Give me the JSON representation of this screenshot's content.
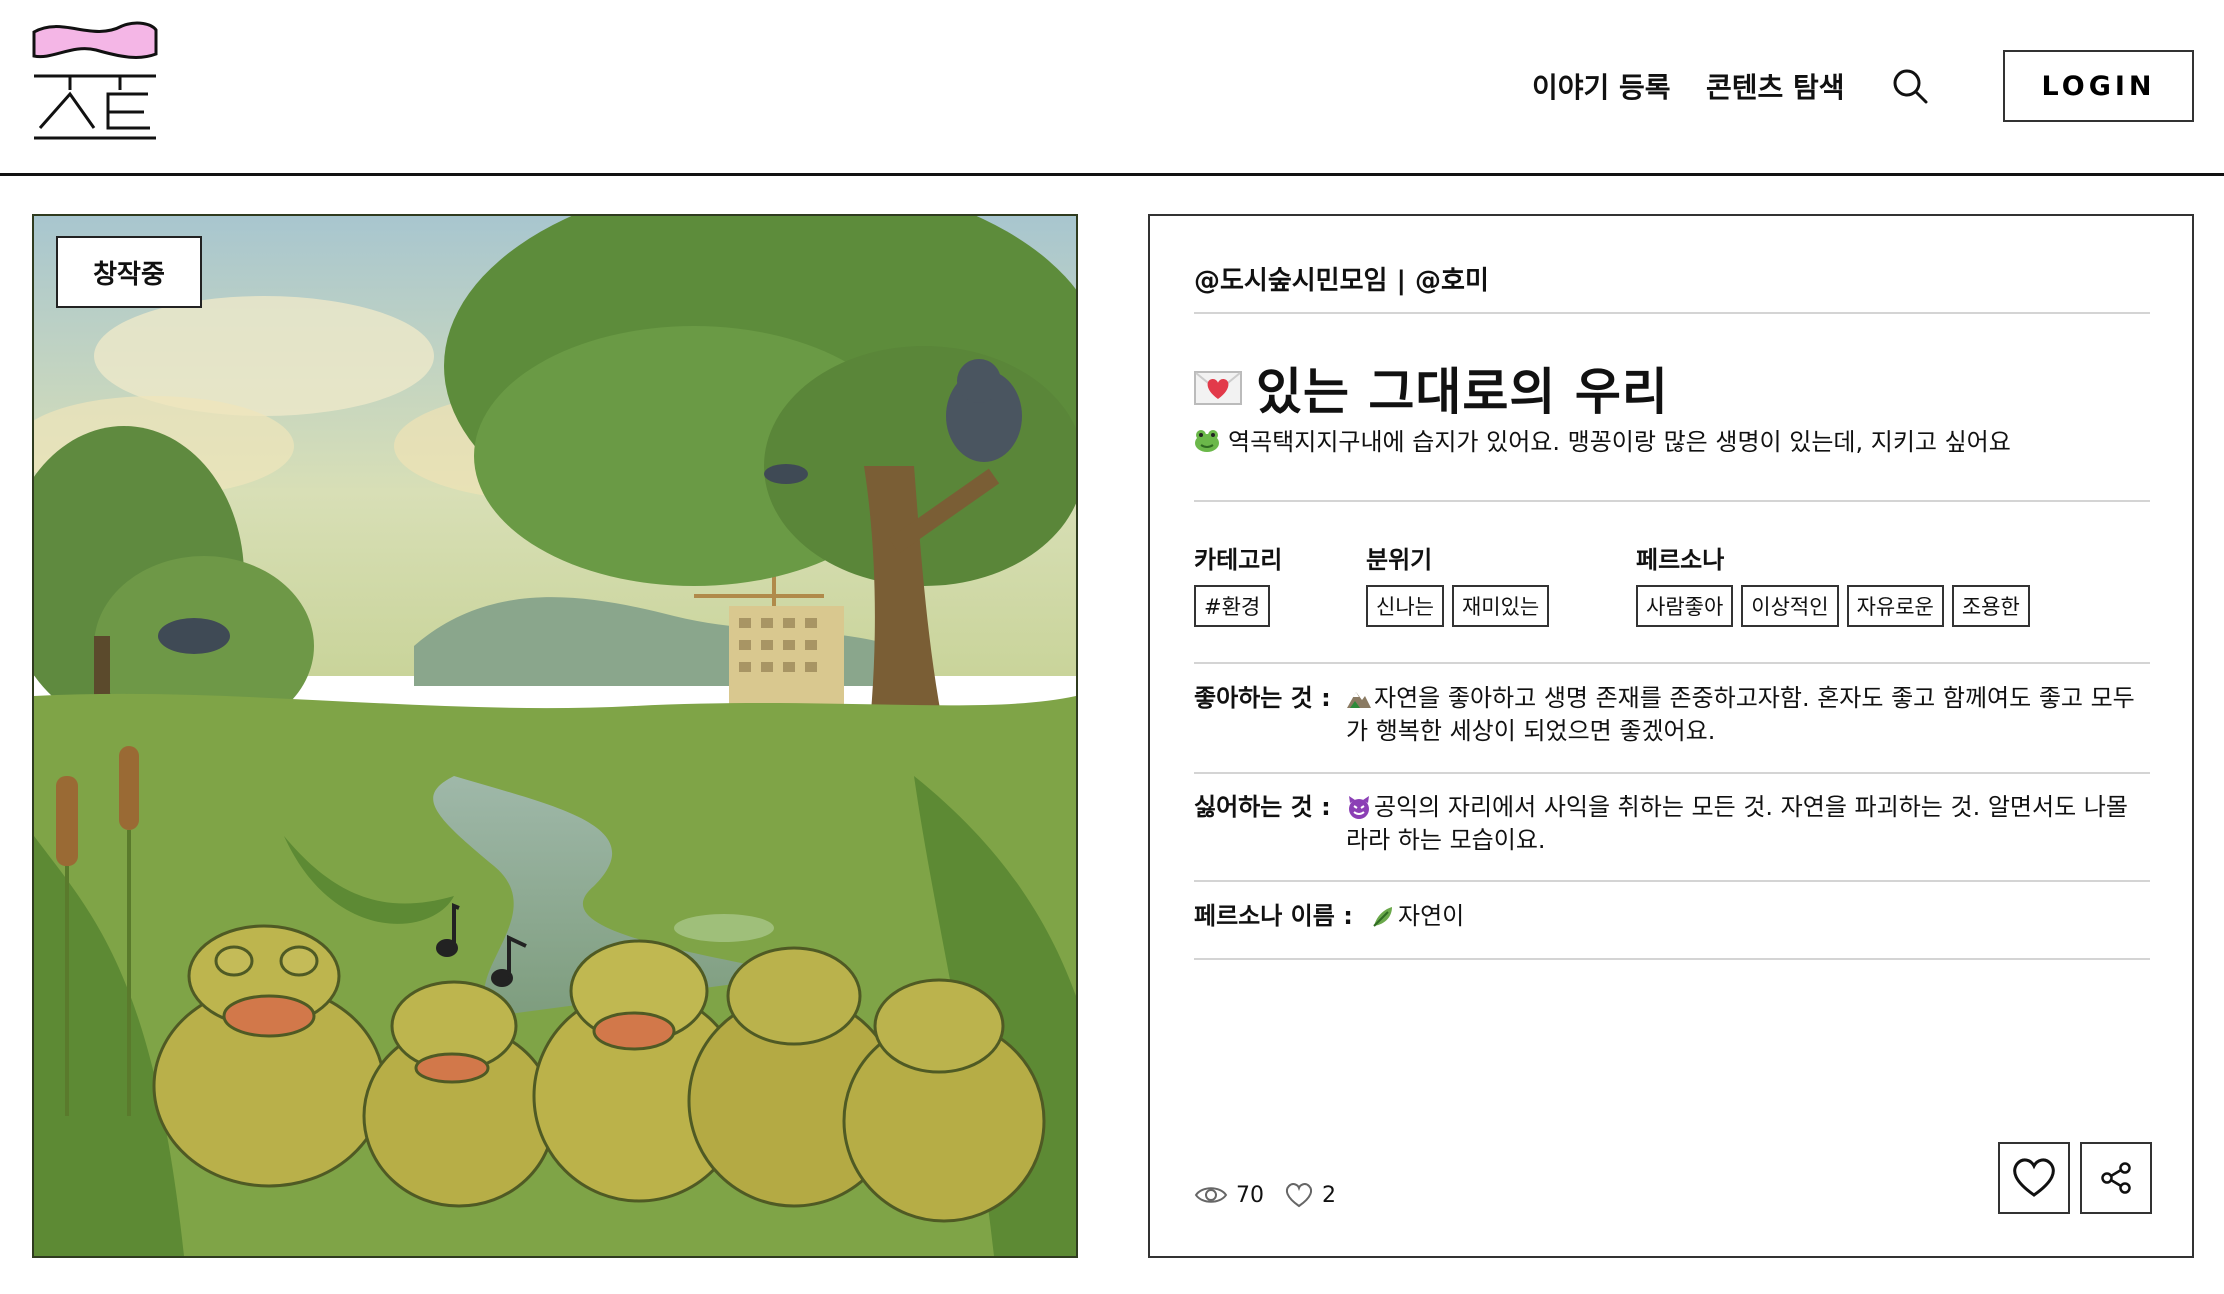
{
  "header": {
    "logo_alt": "스토리 로고",
    "nav": {
      "register": "이야기 등록",
      "explore": "콘텐츠 탐색"
    },
    "login": "LOGIN"
  },
  "artwork": {
    "status": "창작중",
    "icons": [
      "frogs-singing-illustration",
      "music-note-icon"
    ]
  },
  "story": {
    "authors": "@도시숲시민모임 | @호미",
    "title": "있는 그대로의 우리",
    "title_emoji": "love-letter-icon",
    "description": "역곡택지지구내에 습지가 있어요. 맹꽁이랑 많은 생명이 있는데, 지키고 싶어요",
    "description_emoji": "frog-icon",
    "category": {
      "label": "카테고리",
      "tags": [
        "#환경"
      ]
    },
    "mood": {
      "label": "분위기",
      "tags": [
        "신나는",
        "재미있는"
      ]
    },
    "persona": {
      "label": "페르소나",
      "tags": [
        "사람좋아",
        "이상적인",
        "자유로운",
        "조용한"
      ]
    },
    "likes_label": "좋아하는 것 :",
    "likes_text": "자연을 좋아하고 생명 존재를 존중하고자함. 혼자도 좋고 함께여도 좋고 모두가 행복한 세상이 되었으면 좋겠어요.",
    "likes_emoji": "mountain-camping-icon",
    "dislikes_label": "싫어하는 것 :",
    "dislikes_text": "공익의 자리에서 사익을 취하는 모든 것. 자연을 파괴하는 것. 알면서도 나몰라라 하는 모습이요.",
    "dislikes_emoji": "devil-face-icon",
    "persona_name_label": "페르소나 이름 :",
    "persona_name": "자연이",
    "persona_name_emoji": "herb-leaf-icon",
    "views": "70",
    "likes_count": "2"
  },
  "colors": {
    "logo_pink": "#f4b6e6",
    "border": "#333333",
    "divider": "#d4d4d4",
    "text": "#111111"
  }
}
